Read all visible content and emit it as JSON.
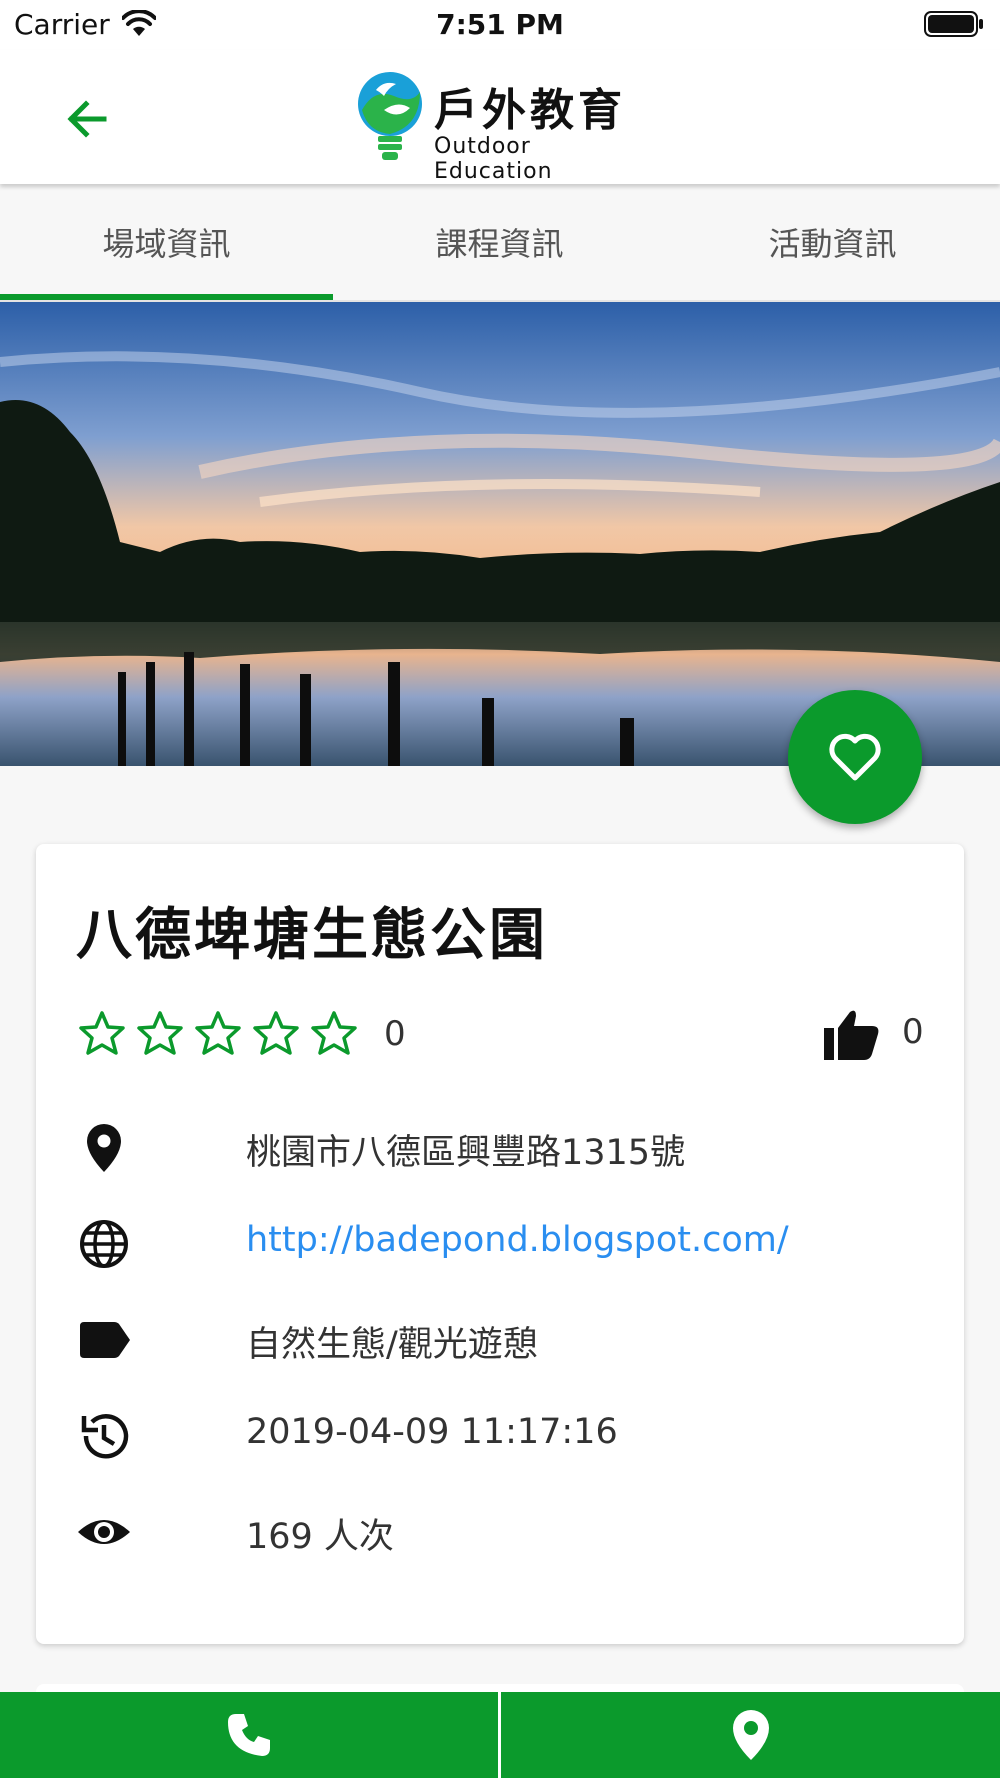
{
  "status_bar": {
    "carrier": "Carrier",
    "time": "7:51 PM"
  },
  "app_bar": {
    "logo_title": "戶外教育",
    "logo_subtitle": "Outdoor Education"
  },
  "tabs": [
    {
      "label": "場域資訊",
      "selected": true
    },
    {
      "label": "課程資訊",
      "selected": false
    },
    {
      "label": "活動資訊",
      "selected": false
    }
  ],
  "venue": {
    "name": "八德埤塘生態公園",
    "rating_stars": 0,
    "rating_max": 5,
    "rating_count": "0",
    "like_count": "0",
    "address": "桃園市八德區興豐路1315號",
    "website": "http://badepond.blogspot.com/",
    "category": "自然生態/觀光遊憩",
    "updated_at": "2019-04-09 11:17:16",
    "views": "169 人次"
  },
  "colors": {
    "accent": "#0b9a2c",
    "link": "#2a8ef0",
    "background": "#f7f7f7"
  },
  "icons": {
    "back": "arrow-left-icon",
    "favorite": "heart-outline-icon",
    "like": "thumb-up-icon",
    "address": "map-pin-icon",
    "website": "globe-icon",
    "category": "label-tag-icon",
    "updated": "history-clock-icon",
    "views": "eye-icon",
    "call": "phone-icon",
    "map": "location-pin-icon"
  }
}
